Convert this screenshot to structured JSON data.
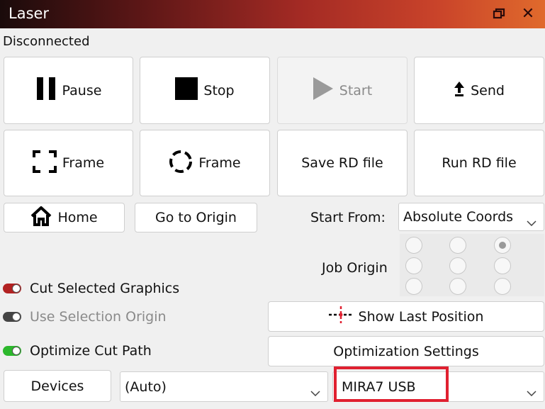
{
  "window": {
    "title": "Laser",
    "restore_icon": "restore-icon",
    "close_icon": "close-icon",
    "close_glyph": "✕"
  },
  "status": "Disconnected",
  "buttons": {
    "pause": "Pause",
    "stop": "Stop",
    "start": "Start",
    "send": "Send",
    "frame_rect": "Frame",
    "frame_circle": "Frame",
    "save_rd": "Save RD file",
    "run_rd": "Run RD file",
    "home": "Home",
    "go_to_origin": "Go to Origin",
    "show_last_position": "Show Last Position",
    "optimization_settings": "Optimization Settings",
    "devices": "Devices"
  },
  "start_from": {
    "label": "Start From:",
    "selected": "Absolute Coords"
  },
  "job_origin": {
    "label": "Job Origin",
    "selected_index": 2,
    "count": 9
  },
  "toggles": [
    {
      "label": "Cut Selected Graphics",
      "on": true,
      "color": "#b22222",
      "enabled": true
    },
    {
      "label": "Use Selection Origin",
      "on": false,
      "color": "#444444",
      "enabled": false
    },
    {
      "label": "Optimize Cut Path",
      "on": true,
      "color": "#2db82d",
      "enabled": true
    }
  ],
  "port_select": {
    "selected": "(Auto)"
  },
  "device_select": {
    "selected": "MIRA7 USB"
  },
  "colors": {
    "highlight": "#e02030"
  }
}
